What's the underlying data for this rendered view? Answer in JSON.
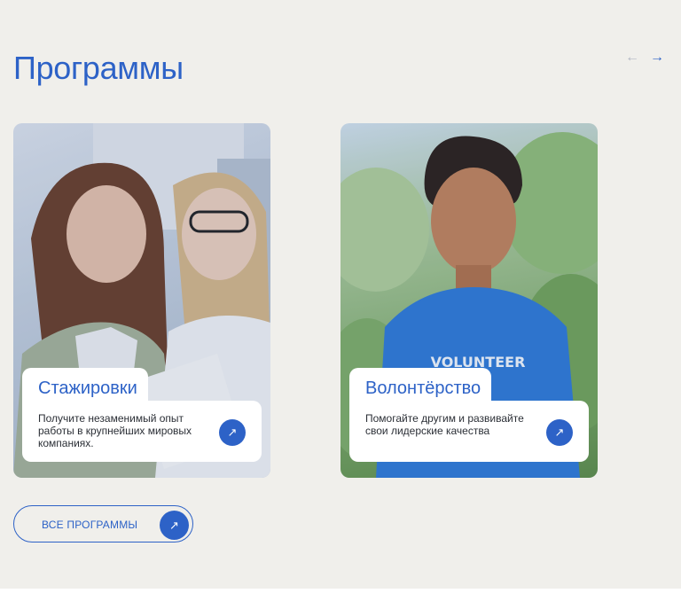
{
  "section": {
    "title": "Программы",
    "prev_icon": "←",
    "next_icon": "→"
  },
  "cards": [
    {
      "title": "Стажировки",
      "description": "Получите незаменимый опыт работы в крупнейших мировых компаниях.",
      "icon": "↗"
    },
    {
      "title": "Волонтёрство",
      "description": "Помогайте другим и развивайте свои лидерские качества",
      "icon": "↗"
    }
  ],
  "all_button": {
    "label": "ВСЕ ПРОГРАММЫ",
    "icon": "↗"
  },
  "colors": {
    "accent": "#2d62c7",
    "background": "#f0efeb",
    "arrow_disabled": "#b3b8c4"
  }
}
